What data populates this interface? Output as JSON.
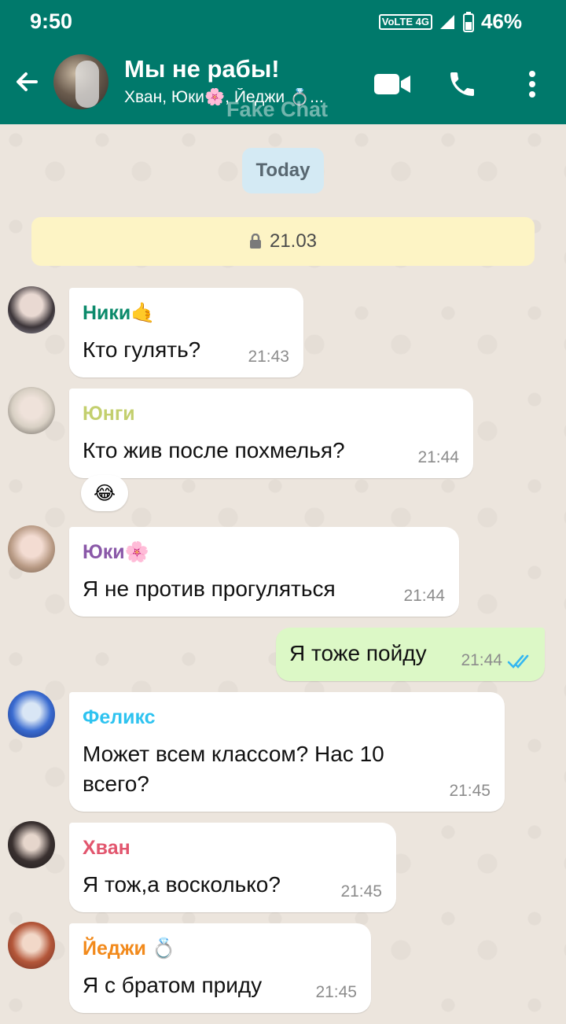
{
  "status_bar": {
    "time": "9:50",
    "network": "VoLTE 4G",
    "battery": "46%"
  },
  "header": {
    "title": "Мы не рабы!",
    "subtitle": "Хван, Юки🌸, Йеджи 💍...",
    "watermark": "Fake Chat"
  },
  "date_chip": "Today",
  "notice": "21.03",
  "colors": {
    "header": "#00796b",
    "incoming": "#ffffff",
    "outgoing": "#dcf8c6",
    "tick": "#34b7f1"
  },
  "messages": [
    {
      "sender": "Ники🤙",
      "sender_color": "#0b8a6b",
      "text": "Кто гулять?",
      "time": "21:43"
    },
    {
      "sender": "Юнги",
      "sender_color": "#c3cf6e",
      "text": "Кто жив после похмелья?",
      "time": "21:44",
      "reaction": "😂"
    },
    {
      "sender": "Юки🌸",
      "sender_color": "#8a58a8",
      "text": "Я не против прогуляться",
      "time": "21:44"
    },
    {
      "outgoing": true,
      "text": "Я тоже пойду",
      "time": "21:44",
      "read": true
    },
    {
      "sender": "Феликс",
      "sender_color": "#2ec3f0",
      "text": "Может всем классом? Нас 10 всего?",
      "time": "21:45"
    },
    {
      "sender": "Хван",
      "sender_color": "#e2566e",
      "text": "Я тож,а восколько?",
      "time": "21:45"
    },
    {
      "sender": "Йеджи 💍",
      "sender_color": "#f28a1c",
      "text": "Я с братом приду",
      "time": "21:45"
    }
  ]
}
